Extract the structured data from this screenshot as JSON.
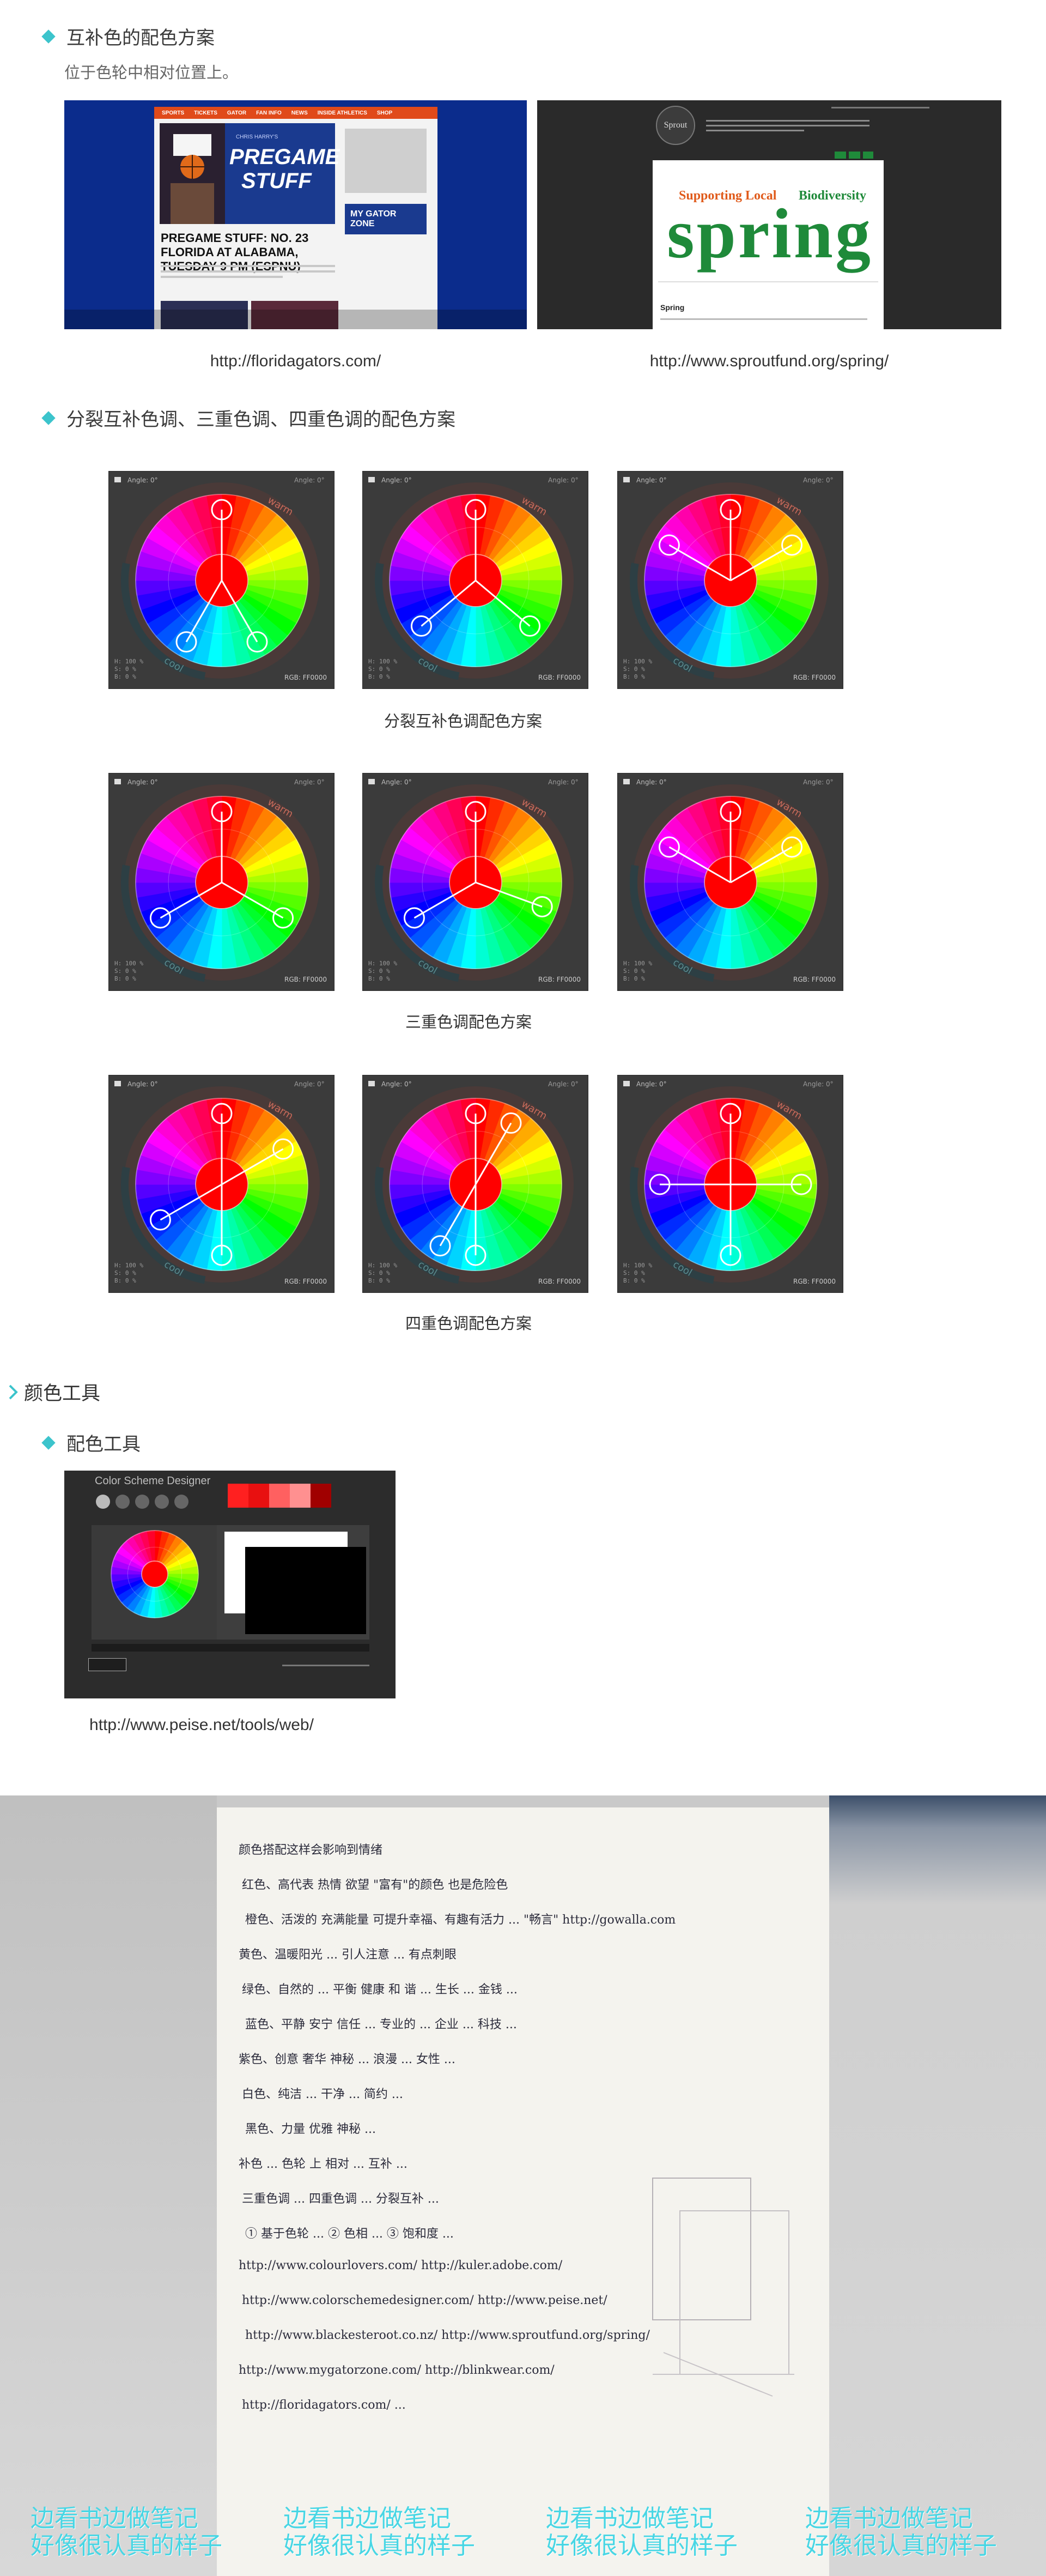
{
  "sections": {
    "complementary": {
      "title": "互补色的配色方案",
      "subtitle": "位于色轮中相对位置上。",
      "examples": [
        {
          "url": "http://floridagators.com/"
        },
        {
          "url": "http://www.sproutfund.org/spring/"
        }
      ]
    },
    "split": {
      "title": "分裂互补色调、三重色调、四重色调的配色方案",
      "captions": [
        "分裂互补色调配色方案",
        "三重色调配色方案",
        "四重色调配色方案"
      ]
    },
    "tools": {
      "category_title": "颜色工具",
      "title": "配色工具",
      "url": "http://www.peise.net/tools/web/"
    }
  },
  "florida_shot": {
    "nav": [
      "SPORTS",
      "TICKETS",
      "GATOR",
      "FAN INFO",
      "NEWS",
      "INSIDE ATHLETICS",
      "SHOP"
    ],
    "hero_brand": "CHRIS HARRY'S",
    "hero_title_1": "PREGAME",
    "hero_title_2": "STUFF",
    "headline": "PREGAME STUFF: NO. 23 FLORIDA AT ALABAMA, TUESDAY 9 PM (ESPNU)",
    "zone_label": "MY GATOR ZONE"
  },
  "sprout_shot": {
    "logo": "Sprout",
    "tagline_1": "Supporting Local",
    "tagline_2": "Biodiversity",
    "wordmark": "spring",
    "section_label": "Spring"
  },
  "wheel": {
    "angle_label": "Angle: 0°",
    "rgb_label": "RGB: FF0000",
    "warm_label": "warm",
    "cool_label": "cool",
    "hsb": [
      "H: 100 %",
      "S: 0 %",
      "B: 0 %"
    ]
  },
  "tool_shot": {
    "title": "Color Scheme Designer",
    "swatches": [
      "#ff2020",
      "#e81010",
      "#ff6060",
      "#ff9090",
      "#a00000"
    ]
  },
  "handwritten": {
    "lines": [
      "颜色搭配这样会影响到情绪",
      "红色、高代表 热情  欲望    \"富有\"的颜色 也是危险色",
      "橙色、活泼的 充满能量 可提升幸福、有趣有活力 ... \"畅言\" http://gowalla.com",
      "黄色、温暖阳光 ... 引人注意 ... 有点刺眼  ",
      "绿色、自然的 ... 平衡 健康 和 谐 ... 生长 ... 金钱 ...",
      "蓝色、平静 安宁 信任 ... 专业的 ... 企业 ... 科技 ...",
      "紫色、创意 奢华 神秘 ... 浪漫 ... 女性 ...",
      "白色、纯洁 ... 干净 ... 简约 ...",
      "黑色、力量 优雅 神秘 ...",
      "补色 ... 色轮 上 相对 ... 互补 ...",
      "三重色调 ... 四重色调 ... 分裂互补 ...",
      "① 基于色轮 ...  ② 色相 ... ③ 饱和度 ...",
      "http://www.colourlovers.com/   http://kuler.adobe.com/",
      "http://www.colorschemedesigner.com/   http://www.peise.net/",
      "http://www.blackesteroot.co.nz/   http://www.sproutfund.org/spring/",
      "http://www.mygatorzone.com/   http://blinkwear.com/",
      "http://floridagators.com/   ..."
    ],
    "watermark_line_1": "边看书边做笔记",
    "watermark_line_2": "好像很认真的样子"
  },
  "colors": {
    "accent": "#3cc4cc",
    "watermark": "#48d6e4"
  }
}
